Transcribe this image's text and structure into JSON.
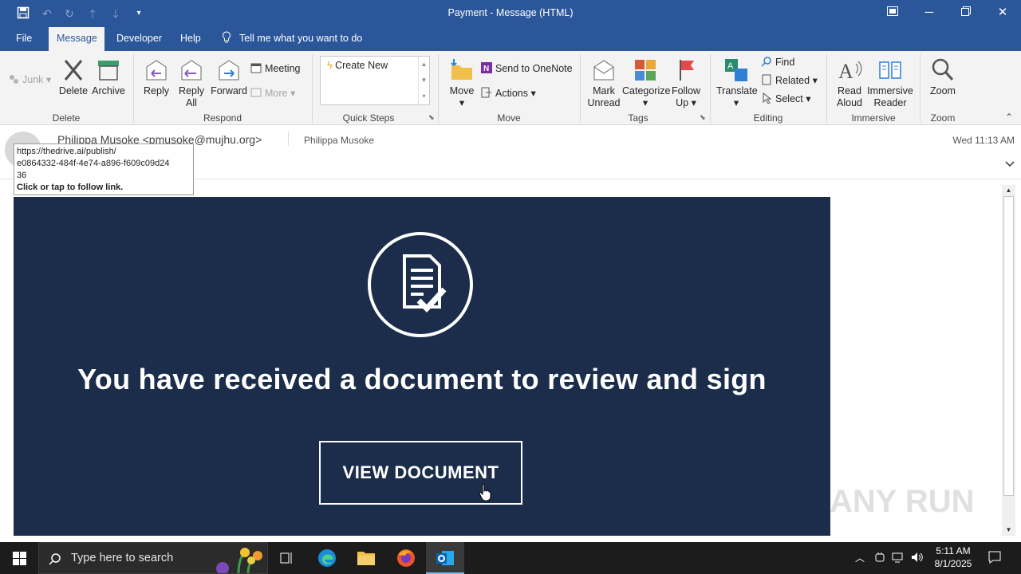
{
  "window": {
    "title": "Payment  -  Message (HTML)",
    "quick_access": [
      "save-icon",
      "undo-icon",
      "redo-icon",
      "up-icon",
      "down-icon",
      "customize-icon"
    ]
  },
  "tabs": [
    {
      "label": "File"
    },
    {
      "label": "Message",
      "active": true
    },
    {
      "label": "Developer"
    },
    {
      "label": "Help"
    }
  ],
  "tell_me": "Tell me what you want to do",
  "ribbon": {
    "delete_group": {
      "junk": "Junk",
      "delete": "Delete",
      "archive": "Archive",
      "label": "Delete"
    },
    "respond_group": {
      "reply": "Reply",
      "reply_all_1": "Reply",
      "reply_all_2": "All",
      "forward": "Forward",
      "meeting": "Meeting",
      "more": "More",
      "label": "Respond"
    },
    "quick_steps": {
      "create_new": "Create New",
      "label": "Quick Steps"
    },
    "move_group": {
      "move": "Move",
      "onenote": "Send to OneNote",
      "actions": "Actions",
      "label": "Move"
    },
    "tags_group": {
      "mark_1": "Mark",
      "mark_2": "Unread",
      "categorize": "Categorize",
      "follow_1": "Follow",
      "follow_2": "Up",
      "label": "Tags"
    },
    "editing_group": {
      "translate": "Translate",
      "find": "Find",
      "related": "Related",
      "select": "Select",
      "label": "Editing"
    },
    "immersive_group": {
      "read_1": "Read",
      "read_2": "Aloud",
      "reader_1": "Immersive",
      "reader_2": "Reader",
      "label": "Immersive"
    },
    "zoom_group": {
      "zoom": "Zoom",
      "label": "Zoom"
    }
  },
  "message": {
    "from": "Philippa Musoke <pmusoke@mujhu.org>",
    "to": "Philippa Musoke",
    "date": "Wed 11:13 AM"
  },
  "tooltip": {
    "line1": "https://thedrive.ai/publish/",
    "line2": "e0864332-484f-4e74-a896-f609c09d24",
    "line3": "36",
    "hint": "Click or tap to follow link."
  },
  "email_body": {
    "headline": "You have received a document to review and sign",
    "button": "VIEW DOCUMENT",
    "banner_color": "#1b2d4b"
  },
  "watermark": "ANY RUN",
  "taskbar": {
    "search_placeholder": "Type here to search",
    "time": "5:11 AM",
    "date": "8/1/2025"
  },
  "colors": {
    "accent": "#2b579a",
    "taskbar": "#1c1c1c"
  }
}
